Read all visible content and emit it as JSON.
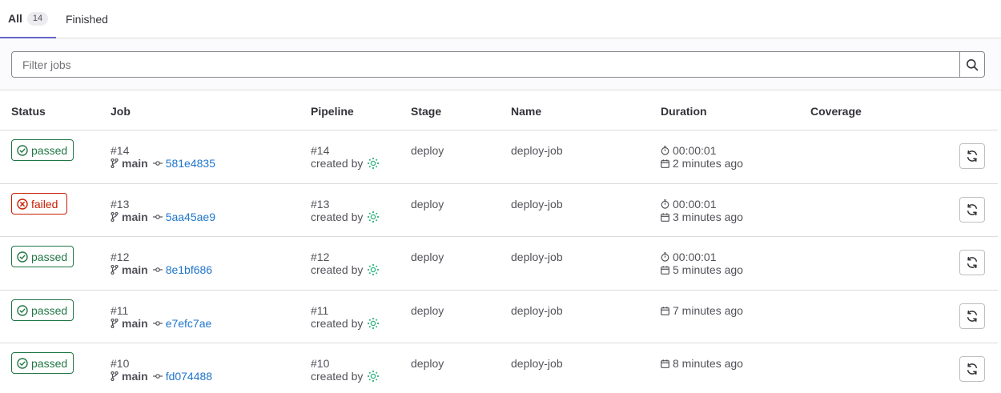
{
  "tabs": [
    {
      "label": "All",
      "count": "14"
    },
    {
      "label": "Finished"
    }
  ],
  "filter": {
    "placeholder": "Filter jobs"
  },
  "table": {
    "columns": [
      "Status",
      "Job",
      "Pipeline",
      "Stage",
      "Name",
      "Duration",
      "Coverage"
    ]
  },
  "jobs": [
    {
      "status": "passed",
      "job_id": "#14",
      "ref": "main",
      "sha": "581e4835",
      "pipeline_id": "#14",
      "created_by": "created by",
      "stage": "deploy",
      "name": "deploy-job",
      "duration": "00:00:01",
      "finished": "2 minutes ago"
    },
    {
      "status": "failed",
      "job_id": "#13",
      "ref": "main",
      "sha": "5aa45ae9",
      "pipeline_id": "#13",
      "created_by": "created by",
      "stage": "deploy",
      "name": "deploy-job",
      "duration": "00:00:01",
      "finished": "3 minutes ago"
    },
    {
      "status": "passed",
      "job_id": "#12",
      "ref": "main",
      "sha": "8e1bf686",
      "pipeline_id": "#12",
      "created_by": "created by",
      "stage": "deploy",
      "name": "deploy-job",
      "duration": "00:00:01",
      "finished": "5 minutes ago"
    },
    {
      "status": "passed",
      "job_id": "#11",
      "ref": "main",
      "sha": "e7efc7ae",
      "pipeline_id": "#11",
      "created_by": "created by",
      "stage": "deploy",
      "name": "deploy-job",
      "finished": "7 minutes ago"
    },
    {
      "status": "passed",
      "job_id": "#10",
      "ref": "main",
      "sha": "fd074488",
      "pipeline_id": "#10",
      "created_by": "created by",
      "stage": "deploy",
      "name": "deploy-job",
      "finished": "8 minutes ago"
    }
  ],
  "icons": {
    "passed": "status-success-icon",
    "failed": "status-failed-icon",
    "branch": "branch-icon",
    "commit": "commit-icon",
    "timer": "timer-icon",
    "calendar": "calendar-icon",
    "retry": "retry-icon",
    "search": "search-icon"
  },
  "colors": {
    "passed": "#217645",
    "failed": "#c91c00",
    "link": "#1f75cb",
    "active_tab": "#6666c4"
  }
}
